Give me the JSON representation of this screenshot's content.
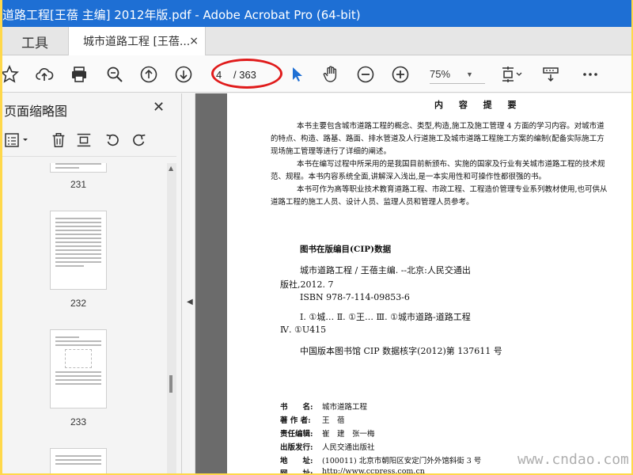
{
  "window": {
    "title": "道路工程[王蓓 主编] 2012年版.pdf - Adobe Acrobat Pro (64-bit)",
    "accent": "#1e6fd4"
  },
  "tabs": {
    "tools_label": "工具",
    "doc_label": "城市道路工程 [王蓓...",
    "close_glyph": "×"
  },
  "toolbar": {
    "current_page": "4",
    "page_total": "/ 363",
    "zoom": "75%",
    "icons": [
      "star-icon",
      "cloud-upload-icon",
      "print-icon",
      "zoom-search-icon",
      "page-up-icon",
      "page-down-icon",
      "select-cursor-icon",
      "hand-icon",
      "zoom-out-icon",
      "zoom-in-icon",
      "fit-page-icon",
      "scroll-mode-icon",
      "more-icon"
    ]
  },
  "left_panel": {
    "title": "页面缩略图",
    "close_glyph": "✕",
    "thumbnails": [
      {
        "label": "231"
      },
      {
        "label": "232"
      },
      {
        "label": "233"
      }
    ]
  },
  "document": {
    "heading": "内 容 提 要",
    "paragraphs": [
      "本书主要包含城市道路工程的概念、类型,构造,施工及施工管理 4 方面的学习内容。对城市道",
      "的特点、构造、路基、路面、排水管道及人行道施工及城市道路工程施工方案的编制(配备实际施工方",
      "现场施工管理等进行了详细的阐述。",
      "本书在编写过程中所采用的是我国目前新颁布、实施的国家及行业有关城市道路工程的技术规",
      "范、规程。本书内容系统全面,讲解深入浅出,是一本实用性和可操作性都很强的书。",
      "本书可作为高等职业技术教育道路工程、市政工程、工程造价管理专业系列教材使用,也可供从",
      "道路工程的施工人员、设计人员、监理人员和管理人员参考。"
    ],
    "cip_title": "图书在版编目(CIP)数据",
    "cip_line1": "城市道路工程 / 王蓓主编. --北京:人民交通出",
    "cip_line2": "版社,2012. 7",
    "cip_isbn": "ISBN 978-7-114-09853-6",
    "cip_class1": "Ⅰ. ①城…   Ⅱ. ①王…   Ⅲ. ①城市道路-道路工程",
    "cip_class2": "Ⅳ. ①U415",
    "cip_number": "中国版本图书馆 CIP 数据核字(2012)第 137611 号",
    "info": [
      {
        "k": "书　　名:",
        "v": "城市道路工程"
      },
      {
        "k": "著 作 者:",
        "v": "王　蓓"
      },
      {
        "k": "责任编辑:",
        "v": "崔　建　张一梅"
      },
      {
        "k": "出版发行:",
        "v": "人民交通出版社"
      },
      {
        "k": "地　　址:",
        "v": "(100011) 北京市朝阳区安定门外外馆斜街 3 号"
      },
      {
        "k": "网　　址:",
        "v": "http://www.ccpress.com.cn"
      }
    ]
  },
  "watermark": "www.cndao.com"
}
